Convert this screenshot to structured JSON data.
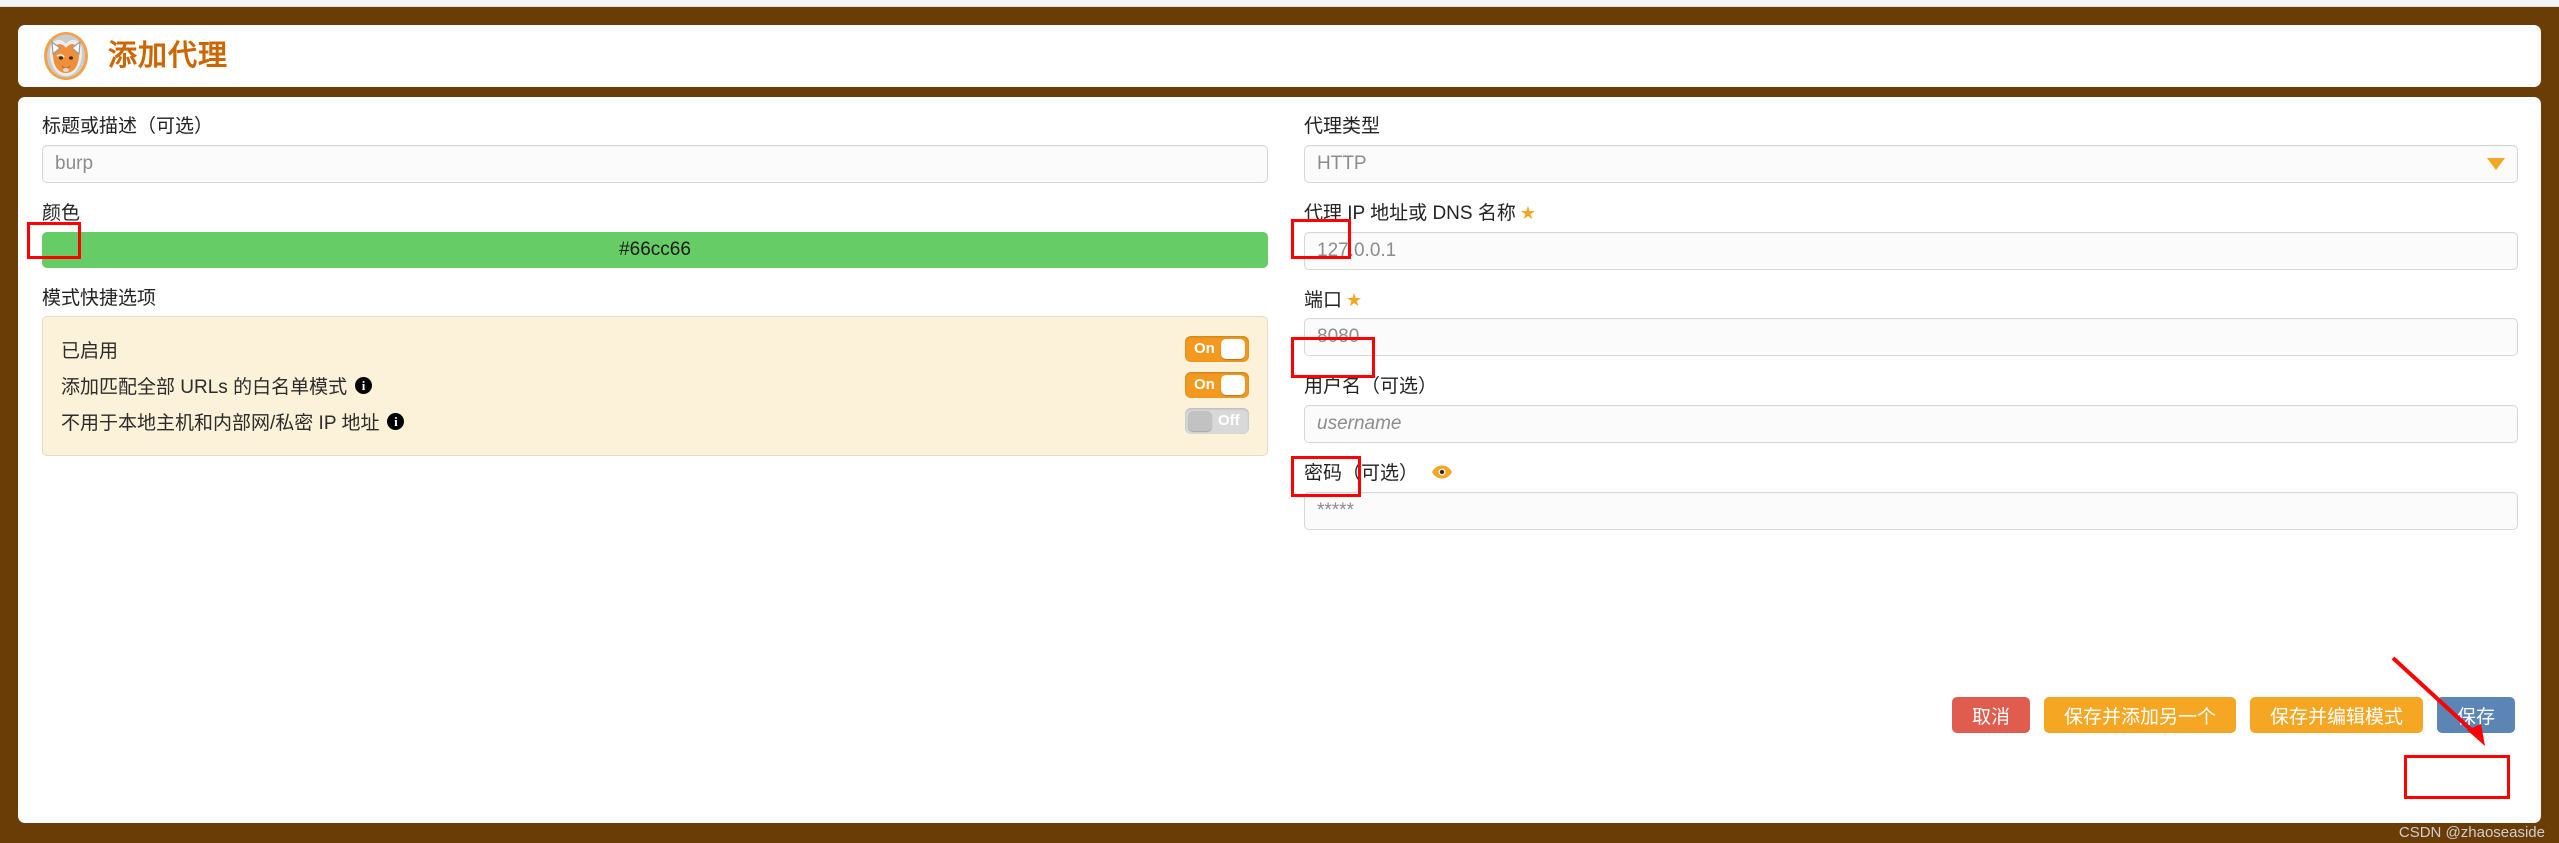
{
  "window": {
    "frame_color": "#6b3d06",
    "card_bg": "#ffffff"
  },
  "header": {
    "title": "添加代理",
    "title_color": "#cc6600",
    "logo_name": "foxyproxy-fox-logo"
  },
  "left_column": {
    "title_field": {
      "label": "标题或描述（可选）",
      "value": "burp",
      "annotated": true
    },
    "color_field": {
      "label": "颜色",
      "value": "#66cc66",
      "swatch_color": "#66cc66"
    },
    "mode_section": {
      "label": "模式快捷选项",
      "panel_bg": "#fcf2d9",
      "rows": [
        {
          "text": "已启用",
          "has_info": false,
          "toggle": "On",
          "toggle_state": "on"
        },
        {
          "text": "添加匹配全部 URLs 的白名单模式",
          "has_info": true,
          "toggle": "On",
          "toggle_state": "on"
        },
        {
          "text": "不用于本地主机和内部网/私密 IP 地址",
          "has_info": true,
          "toggle": "Off",
          "toggle_state": "off"
        }
      ]
    }
  },
  "right_column": {
    "proxy_type": {
      "label": "代理类型",
      "value": "HTTP",
      "annotated": true,
      "caret_color": "#f5a623"
    },
    "host": {
      "label": "代理 IP 地址或 DNS 名称",
      "required_star": "★",
      "value": "127.0.0.1",
      "annotated": true
    },
    "port": {
      "label": "端口",
      "required_star": "★",
      "value": "8080",
      "annotated": true
    },
    "username": {
      "label": "用户名（可选）",
      "placeholder": "username"
    },
    "password": {
      "label": "密码（可选）",
      "eye_icon": "eye-icon",
      "placeholder": "*****"
    }
  },
  "buttons": {
    "cancel": "取消",
    "save_and_add_another": "保存并添加另一个",
    "save_and_edit_patterns": "保存并编辑模式",
    "save": "保存"
  },
  "watermark": "CSDN @zhaoseaside"
}
